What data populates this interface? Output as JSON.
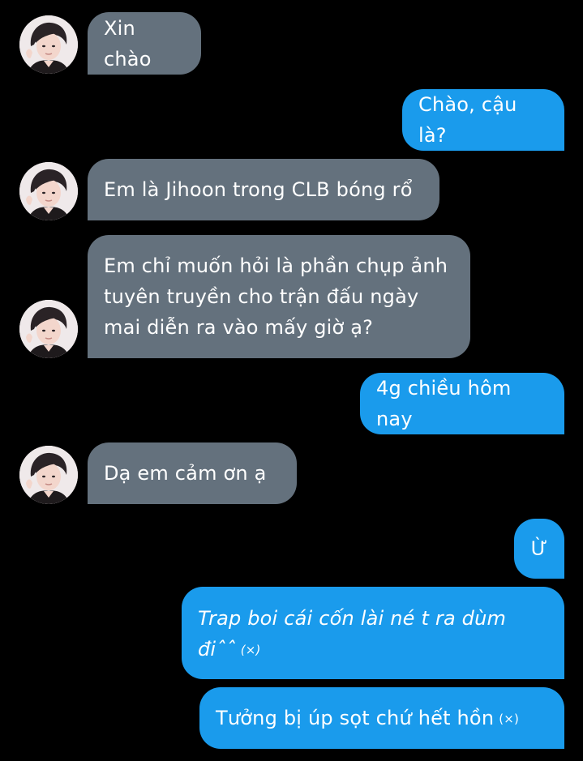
{
  "messages": [
    {
      "side": "incoming",
      "text": "Xin chào"
    },
    {
      "side": "outgoing",
      "text": "Chào, cậu là?"
    },
    {
      "side": "incoming",
      "text": "Em là Jihoon trong CLB bóng rổ"
    },
    {
      "side": "incoming",
      "text": "Em chỉ muốn hỏi là phần chụp ảnh tuyên truyền cho trận đấu ngày mai diễn ra vào mấy giờ ạ?"
    },
    {
      "side": "outgoing",
      "text": "4g chiều hôm nay"
    },
    {
      "side": "incoming",
      "text": "Dạ em cảm ơn ạ"
    },
    {
      "side": "outgoing",
      "text": "Ừ"
    },
    {
      "side": "outgoing",
      "text": "Trap boi cái cốn lài né t ra dùm điˆˆ",
      "suffix": "(×)"
    },
    {
      "side": "outgoing",
      "text": "Tưởng bị úp sọt chứ hết hồn",
      "suffix": "(×)"
    }
  ],
  "colors": {
    "background": "#000000",
    "incoming_bubble": "#64717d",
    "outgoing_bubble": "#1a9bec",
    "text": "#ffffff"
  },
  "icons": {
    "avatar": "profile-photo-icon"
  }
}
